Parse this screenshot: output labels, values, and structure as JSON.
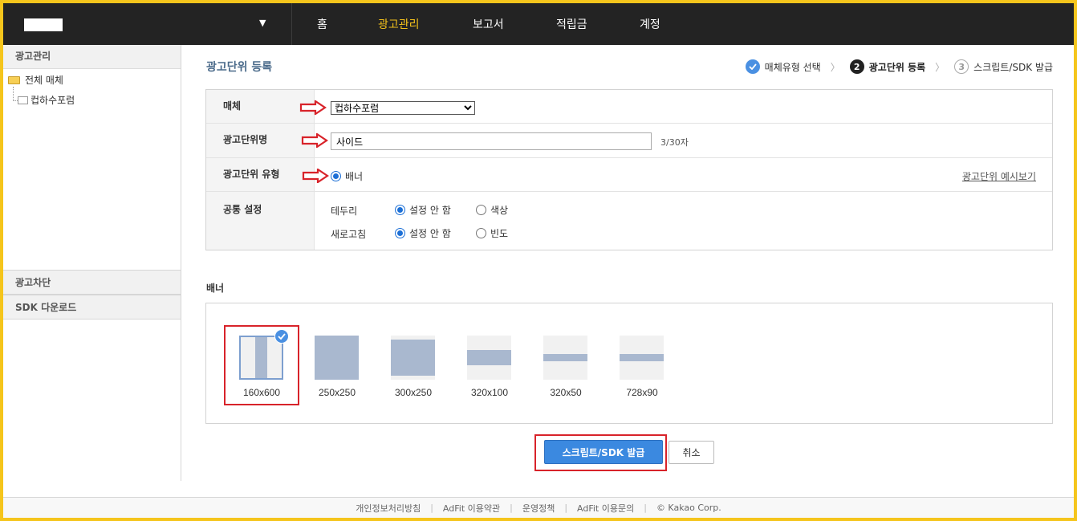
{
  "nav": {
    "items": [
      {
        "label": "홈",
        "active": false
      },
      {
        "label": "광고관리",
        "active": true
      },
      {
        "label": "보고서",
        "active": false
      },
      {
        "label": "적립금",
        "active": false
      },
      {
        "label": "계정",
        "active": false
      }
    ],
    "active_color": "#f3c11b"
  },
  "sidebar": {
    "header": "광고관리",
    "tree_root": "전체 매체",
    "tree_child": "컵하수포럼",
    "section1": "광고차단",
    "section2": "SDK 다운로드"
  },
  "page": {
    "title": "광고단위 등록"
  },
  "steps": [
    {
      "icon": "check",
      "label": "매체유형 선택",
      "state": "done"
    },
    {
      "icon": "2",
      "label": "광고단위 등록",
      "state": "current"
    },
    {
      "icon": "3",
      "label": "스크립트/SDK 발급",
      "state": "next"
    }
  ],
  "form": {
    "media_label": "매체",
    "media_value": "컵하수포럼",
    "name_label": "광고단위명",
    "name_value": "사이드",
    "name_counter": "3/30자",
    "type_label": "광고단위 유형",
    "type_option": "배너",
    "preview_link": "광고단위 예시보기",
    "common_label": "공통 설정",
    "border_label": "테두리",
    "border_opt1": "설정 안 함",
    "border_opt2": "색상",
    "refresh_label": "새로고침",
    "refresh_opt1": "설정 안 함",
    "refresh_opt2": "빈도"
  },
  "banner": {
    "title": "배너",
    "selected": "160x600",
    "sizes": [
      "160x600",
      "250x250",
      "300x250",
      "320x100",
      "320x50",
      "728x90"
    ]
  },
  "buttons": {
    "issue": "스크립트/SDK 발급",
    "cancel": "취소"
  },
  "footer": {
    "links": [
      "개인정보처리방침",
      "AdFit 이용약관",
      "운영정책",
      "AdFit 이용문의"
    ],
    "copyright": "© Kakao Corp."
  },
  "colors": {
    "accent_blue": "#3b89e0",
    "highlight_red": "#d8232a",
    "topbar": "#232323",
    "frame": "#f5c51c"
  }
}
